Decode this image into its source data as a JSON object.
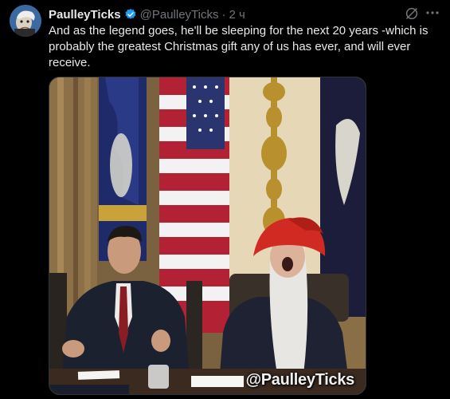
{
  "tweet": {
    "author_name": "PaulleyTicks",
    "handle": "@PaulleyTicks",
    "separator": "·",
    "time": "2 ч",
    "text": "And as the legend goes, he'll be sleeping for the next 20 years -which is probably the greatest Christmas gift any of us has ever, and will ever receive.",
    "verified": true,
    "icons": {
      "verified": "verified-badge-icon",
      "grok": "grok-icon",
      "more": "more-icon"
    },
    "media": {
      "watermark": "@PaulleyTicks"
    }
  },
  "colors": {
    "background": "#000000",
    "text": "#e7e9ea",
    "muted": "#71767b",
    "verified": "#1d9bf0",
    "border": "#2f3336"
  }
}
